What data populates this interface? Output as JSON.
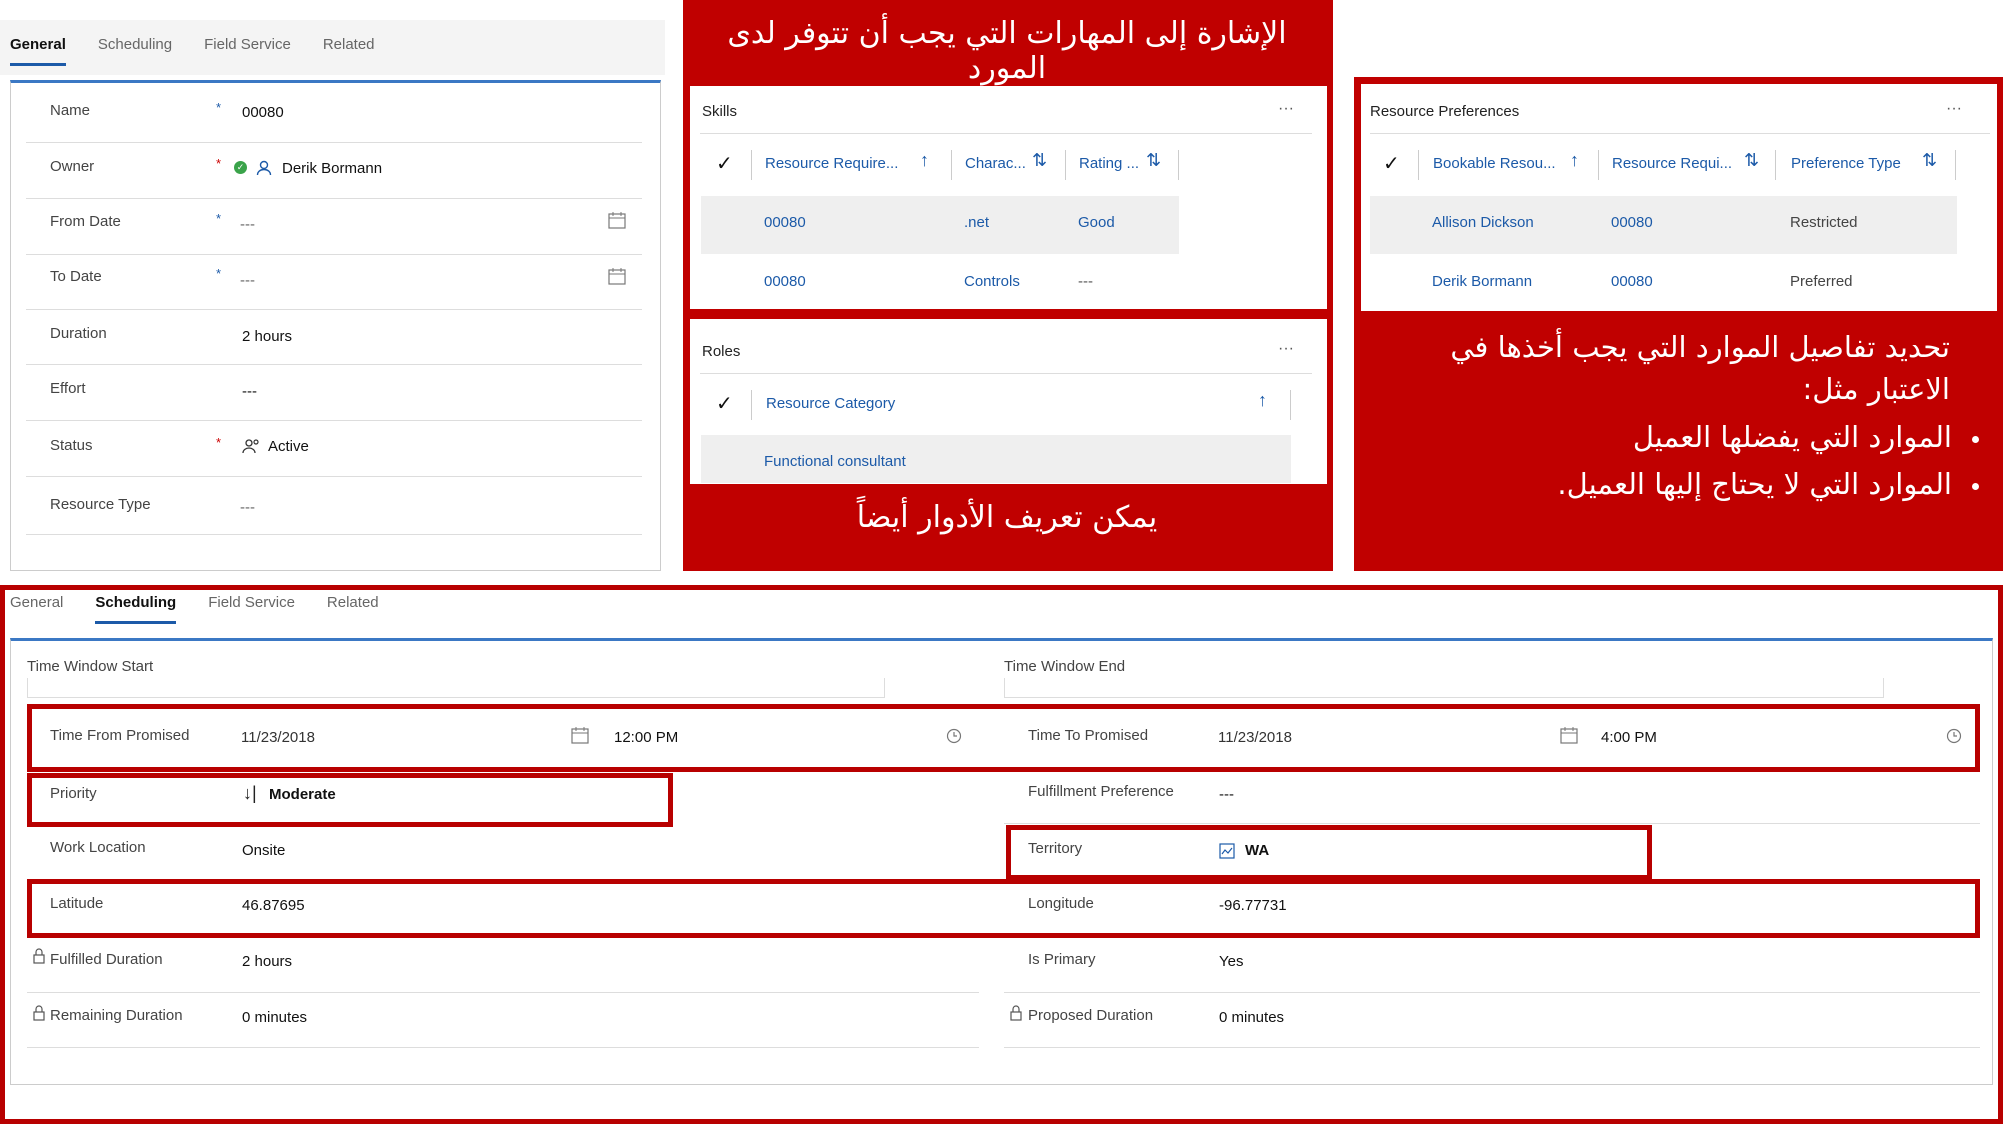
{
  "top_form": {
    "tabs": [
      "General",
      "Scheduling",
      "Field Service",
      "Related"
    ],
    "fields": [
      {
        "label": "Name",
        "value": "00080"
      },
      {
        "label": "Owner",
        "value": "Derik Bormann"
      },
      {
        "label": "From Date",
        "value": "---"
      },
      {
        "label": "To Date",
        "value": "---"
      },
      {
        "label": "Duration",
        "value": "2 hours"
      },
      {
        "label": "Effort",
        "value": "---"
      },
      {
        "label": "Status",
        "value": "Active"
      },
      {
        "label": "Resource Type",
        "value": "---"
      }
    ]
  },
  "annotations": {
    "skills": "الإشارة إلى المهارات التي يجب أن تتوفر لدى المورد",
    "roles": "يمكن تعريف الأدوار أيضاً",
    "prefs_line1": "تحديد تفاصيل الموارد التي يجب أخذها في",
    "prefs_line2": "الاعتبار مثل:",
    "bullet1": "الموارد التي يفضلها العميل",
    "bullet2": "الموارد التي لا يحتاج إليها العميل."
  },
  "skills": {
    "title": "Skills",
    "more": "···",
    "headers": [
      "Resource Require...",
      "Charac...",
      "Rating ..."
    ],
    "rows": [
      [
        "00080",
        ".net",
        "Good"
      ],
      [
        "00080",
        "Controls",
        "---"
      ]
    ]
  },
  "roles": {
    "title": "Roles",
    "more": "···",
    "header": "Resource Category",
    "rows": [
      "Functional consultant"
    ]
  },
  "prefs": {
    "title": "Resource Preferences",
    "more": "···",
    "headers": [
      "Bookable Resou...",
      "Resource Requi...",
      "Preference Type"
    ],
    "rows": [
      [
        "Allison Dickson",
        "00080",
        "Restricted"
      ],
      [
        "Derik Bormann",
        "00080",
        "Preferred"
      ]
    ]
  },
  "sched": {
    "tabs": [
      "General",
      "Scheduling",
      "Field Service",
      "Related"
    ],
    "tws": "Time Window Start",
    "twe": "Time Window End",
    "tfp_label": "Time From Promised",
    "tfp_date": "11/23/2018",
    "tfp_time": "12:00 PM",
    "ttp_label": "Time To Promised",
    "ttp_date": "11/23/2018",
    "ttp_time": "4:00 PM",
    "priority_label": "Priority",
    "priority": "Moderate",
    "fp_label": "Fulfillment Preference",
    "fp": "---",
    "wl_label": "Work Location",
    "wl": "Onsite",
    "territory_label": "Territory",
    "territory": "WA",
    "lat_label": "Latitude",
    "lat": "46.87695",
    "lon_label": "Longitude",
    "lon": "-96.77731",
    "fd_label": "Fulfilled Duration",
    "fd": "2 hours",
    "ip_label": "Is Primary",
    "ip": "Yes",
    "rd_label": "Remaining Duration",
    "rd": "0 minutes",
    "pd_label": "Proposed Duration",
    "pd": "0 minutes"
  }
}
